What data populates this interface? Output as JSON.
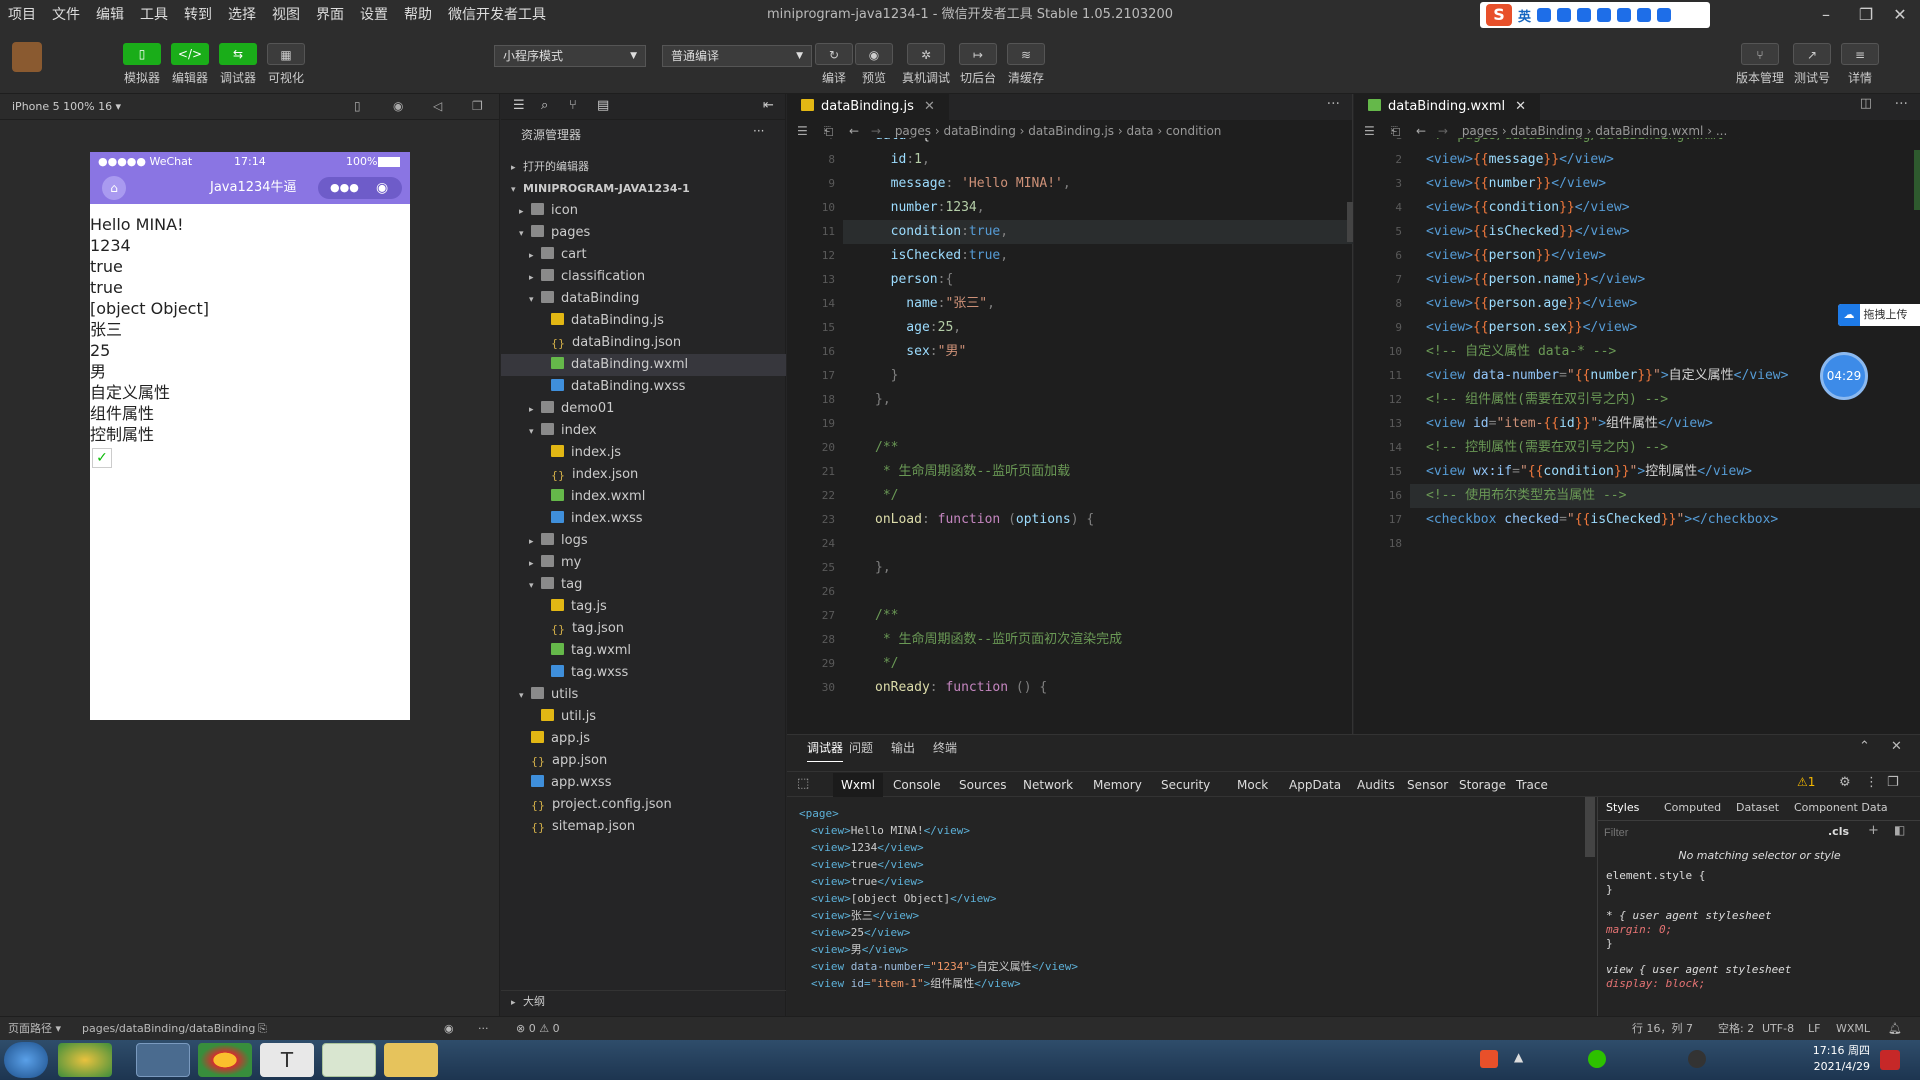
{
  "menu": [
    "项目",
    "文件",
    "编辑",
    "工具",
    "转到",
    "选择",
    "视图",
    "界面",
    "设置",
    "帮助",
    "微信开发者工具"
  ],
  "window_title": "miniprogram-java1234-1 - 微信开发者工具 Stable 1.05.2103200",
  "ime": {
    "mode": "英"
  },
  "toolbar": {
    "simulator": "模拟器",
    "editor": "编辑器",
    "debugger": "调试器",
    "visualize": "可视化",
    "mode_select": "小程序模式",
    "compile_select": "普通编译",
    "compile": "编译",
    "preview": "预览",
    "remote_debug": "真机调试",
    "backend": "切后台",
    "clear_cache": "清缓存",
    "version": "版本管理",
    "test": "测试号",
    "details": "详情"
  },
  "simulator": {
    "device": "iPhone 5 100% 16 ▾",
    "status_left": "●●●●● WeChat",
    "time": "17:14",
    "battery": "100%",
    "nav_title": "Java1234牛逼",
    "lines": [
      "Hello MINA!",
      "1234",
      "true",
      "true",
      "[object Object]",
      "张三",
      "25",
      "男",
      "自定义属性",
      "组件属性",
      "控制属性"
    ]
  },
  "explorer": {
    "title": "资源管理器",
    "open_editors": "打开的编辑器",
    "project": "MINIPROGRAM-JAVA1234-1",
    "outline": "大纲",
    "tree": [
      {
        "label": "icon",
        "depth": 1,
        "type": "folder",
        "twisty": "▸"
      },
      {
        "label": "pages",
        "depth": 1,
        "type": "folder",
        "twisty": "▾"
      },
      {
        "label": "cart",
        "depth": 2,
        "type": "folder",
        "twisty": "▸"
      },
      {
        "label": "classification",
        "depth": 2,
        "type": "folder",
        "twisty": "▸"
      },
      {
        "label": "dataBinding",
        "depth": 2,
        "type": "folder",
        "twisty": "▾"
      },
      {
        "label": "dataBinding.js",
        "depth": 3,
        "type": "js"
      },
      {
        "label": "dataBinding.json",
        "depth": 3,
        "type": "json"
      },
      {
        "label": "dataBinding.wxml",
        "depth": 3,
        "type": "wxml",
        "selected": true
      },
      {
        "label": "dataBinding.wxss",
        "depth": 3,
        "type": "wxss"
      },
      {
        "label": "demo01",
        "depth": 2,
        "type": "folder",
        "twisty": "▸"
      },
      {
        "label": "index",
        "depth": 2,
        "type": "folder",
        "twisty": "▾"
      },
      {
        "label": "index.js",
        "depth": 3,
        "type": "js"
      },
      {
        "label": "index.json",
        "depth": 3,
        "type": "json"
      },
      {
        "label": "index.wxml",
        "depth": 3,
        "type": "wxml"
      },
      {
        "label": "index.wxss",
        "depth": 3,
        "type": "wxss"
      },
      {
        "label": "logs",
        "depth": 2,
        "type": "folder",
        "twisty": "▸"
      },
      {
        "label": "my",
        "depth": 2,
        "type": "folder",
        "twisty": "▸"
      },
      {
        "label": "tag",
        "depth": 2,
        "type": "folder",
        "twisty": "▾"
      },
      {
        "label": "tag.js",
        "depth": 3,
        "type": "js"
      },
      {
        "label": "tag.json",
        "depth": 3,
        "type": "json"
      },
      {
        "label": "tag.wxml",
        "depth": 3,
        "type": "wxml"
      },
      {
        "label": "tag.wxss",
        "depth": 3,
        "type": "wxss"
      },
      {
        "label": "utils",
        "depth": 1,
        "type": "folder",
        "twisty": "▾"
      },
      {
        "label": "util.js",
        "depth": 2,
        "type": "js"
      },
      {
        "label": "app.js",
        "depth": 1,
        "type": "js"
      },
      {
        "label": "app.json",
        "depth": 1,
        "type": "json"
      },
      {
        "label": "app.wxss",
        "depth": 1,
        "type": "wxss"
      },
      {
        "label": "project.config.json",
        "depth": 1,
        "type": "json"
      },
      {
        "label": "sitemap.json",
        "depth": 1,
        "type": "json"
      }
    ]
  },
  "editor_js": {
    "tab": "dataBinding.js",
    "breadcrumb": "pages › dataBinding › dataBinding.js › data › condition",
    "lines": [
      {
        "n": "7",
        "tokens": [
          [
            "p",
            "data"
          ],
          [
            "x",
            ": "
          ],
          [
            "",
            "{"
          ]
        ]
      },
      {
        "n": "8",
        "tokens": [
          [
            "p",
            "  id"
          ],
          [
            "x",
            ":"
          ],
          [
            "n",
            "1"
          ],
          [
            "x",
            ","
          ]
        ]
      },
      {
        "n": "9",
        "tokens": [
          [
            "p",
            "  message"
          ],
          [
            "x",
            ": "
          ],
          [
            "s",
            "'Hello MINA!'"
          ],
          [
            "x",
            ","
          ]
        ]
      },
      {
        "n": "10",
        "tokens": [
          [
            "p",
            "  number"
          ],
          [
            "x",
            ":"
          ],
          [
            "n",
            "1234"
          ],
          [
            "x",
            ","
          ]
        ]
      },
      {
        "n": "11",
        "tokens": [
          [
            "p",
            "  condition"
          ],
          [
            "x",
            ":"
          ],
          [
            "t",
            "true"
          ],
          [
            "x",
            ","
          ]
        ]
      },
      {
        "n": "12",
        "tokens": [
          [
            "p",
            "  isChecked"
          ],
          [
            "x",
            ":"
          ],
          [
            "t",
            "true"
          ],
          [
            "x",
            ","
          ]
        ]
      },
      {
        "n": "13",
        "tokens": [
          [
            "p",
            "  person"
          ],
          [
            "x",
            ":{"
          ]
        ]
      },
      {
        "n": "14",
        "tokens": [
          [
            "p",
            "    name"
          ],
          [
            "x",
            ":"
          ],
          [
            "s",
            "\"张三\""
          ],
          [
            "x",
            ","
          ]
        ]
      },
      {
        "n": "15",
        "tokens": [
          [
            "p",
            "    age"
          ],
          [
            "x",
            ":"
          ],
          [
            "n",
            "25"
          ],
          [
            "x",
            ","
          ]
        ]
      },
      {
        "n": "16",
        "tokens": [
          [
            "p",
            "    sex"
          ],
          [
            "x",
            ":"
          ],
          [
            "s",
            "\"男\""
          ]
        ]
      },
      {
        "n": "17",
        "tokens": [
          [
            "x",
            "  }"
          ]
        ]
      },
      {
        "n": "18",
        "tokens": [
          [
            "x",
            "},"
          ]
        ]
      },
      {
        "n": "19",
        "tokens": []
      },
      {
        "n": "20",
        "tokens": [
          [
            "c",
            "/**"
          ]
        ]
      },
      {
        "n": "21",
        "tokens": [
          [
            "c",
            " * 生命周期函数--监听页面加载"
          ]
        ]
      },
      {
        "n": "22",
        "tokens": [
          [
            "c",
            " */"
          ]
        ]
      },
      {
        "n": "23",
        "tokens": [
          [
            "f",
            "onLoad"
          ],
          [
            "x",
            ": "
          ],
          [
            "k",
            "function"
          ],
          [
            "x",
            " ("
          ],
          [
            "p",
            "options"
          ],
          [
            "x",
            ") {"
          ]
        ]
      },
      {
        "n": "24",
        "tokens": []
      },
      {
        "n": "25",
        "tokens": [
          [
            "x",
            "},"
          ]
        ]
      },
      {
        "n": "26",
        "tokens": []
      },
      {
        "n": "27",
        "tokens": [
          [
            "c",
            "/**"
          ]
        ]
      },
      {
        "n": "28",
        "tokens": [
          [
            "c",
            " * 生命周期函数--监听页面初次渲染完成"
          ]
        ]
      },
      {
        "n": "29",
        "tokens": [
          [
            "c",
            " */"
          ]
        ]
      },
      {
        "n": "30",
        "tokens": [
          [
            "f",
            "onReady"
          ],
          [
            "x",
            ": "
          ],
          [
            "k",
            "function"
          ],
          [
            "x",
            " () {"
          ]
        ]
      }
    ]
  },
  "editor_wxml": {
    "tab": "dataBinding.wxml",
    "breadcrumb": "pages › dataBinding › dataBinding.wxml › ...",
    "upload_label": "拖拽上传",
    "timer": "04:29",
    "lines": [
      {
        "n": "1",
        "tokens": [
          [
            "c",
            "<!--pages/dataBinding/dataBinding.wxml-->"
          ]
        ]
      },
      {
        "n": "2",
        "tokens": [
          [
            "t",
            "<view>"
          ],
          [
            "tr",
            "{{"
          ],
          [
            "p",
            "message"
          ],
          [
            "tr",
            "}}"
          ],
          [
            "t",
            "</view>"
          ]
        ]
      },
      {
        "n": "3",
        "tokens": [
          [
            "t",
            "<view>"
          ],
          [
            "tr",
            "{{"
          ],
          [
            "p",
            "number"
          ],
          [
            "tr",
            "}}"
          ],
          [
            "t",
            "</view>"
          ]
        ]
      },
      {
        "n": "4",
        "tokens": [
          [
            "t",
            "<view>"
          ],
          [
            "tr",
            "{{"
          ],
          [
            "p",
            "condition"
          ],
          [
            "tr",
            "}}"
          ],
          [
            "t",
            "</view>"
          ]
        ]
      },
      {
        "n": "5",
        "tokens": [
          [
            "t",
            "<view>"
          ],
          [
            "tr",
            "{{"
          ],
          [
            "p",
            "isChecked"
          ],
          [
            "tr",
            "}}"
          ],
          [
            "t",
            "</view>"
          ]
        ]
      },
      {
        "n": "6",
        "tokens": [
          [
            "t",
            "<view>"
          ],
          [
            "tr",
            "{{"
          ],
          [
            "p",
            "person"
          ],
          [
            "tr",
            "}}"
          ],
          [
            "t",
            "</view>"
          ]
        ]
      },
      {
        "n": "7",
        "tokens": [
          [
            "t",
            "<view>"
          ],
          [
            "tr",
            "{{"
          ],
          [
            "p",
            "person.name"
          ],
          [
            "tr",
            "}}"
          ],
          [
            "t",
            "</view>"
          ]
        ]
      },
      {
        "n": "8",
        "tokens": [
          [
            "t",
            "<view>"
          ],
          [
            "tr",
            "{{"
          ],
          [
            "p",
            "person.age"
          ],
          [
            "tr",
            "}}"
          ],
          [
            "t",
            "</view>"
          ]
        ]
      },
      {
        "n": "9",
        "tokens": [
          [
            "t",
            "<view>"
          ],
          [
            "tr",
            "{{"
          ],
          [
            "p",
            "person.sex"
          ],
          [
            "tr",
            "}}"
          ],
          [
            "t",
            "</view>"
          ]
        ]
      },
      {
        "n": "10",
        "tokens": [
          [
            "c",
            "<!-- 自定义属性 data-* -->"
          ]
        ]
      },
      {
        "n": "11",
        "tokens": [
          [
            "t",
            "<view "
          ],
          [
            "a",
            "data-number"
          ],
          [
            "x",
            "="
          ],
          [
            "s",
            "\""
          ],
          [
            "tr",
            "{{"
          ],
          [
            "p",
            "number"
          ],
          [
            "tr",
            "}}"
          ],
          [
            "s",
            "\""
          ],
          [
            "t",
            ">"
          ],
          [
            "",
            "自定义属性"
          ],
          [
            "t",
            "</view>"
          ]
        ]
      },
      {
        "n": "12",
        "tokens": [
          [
            "c",
            "<!-- 组件属性(需要在双引号之内) -->"
          ]
        ]
      },
      {
        "n": "13",
        "tokens": [
          [
            "t",
            "<view "
          ],
          [
            "a",
            "id"
          ],
          [
            "x",
            "="
          ],
          [
            "s",
            "\"item-"
          ],
          [
            "tr",
            "{{"
          ],
          [
            "p",
            "id"
          ],
          [
            "tr",
            "}}"
          ],
          [
            "s",
            "\""
          ],
          [
            "t",
            ">"
          ],
          [
            "",
            "组件属性"
          ],
          [
            "t",
            "</view>"
          ]
        ]
      },
      {
        "n": "14",
        "tokens": [
          [
            "c",
            "<!-- 控制属性(需要在双引号之内) -->"
          ]
        ]
      },
      {
        "n": "15",
        "tokens": [
          [
            "t",
            "<view "
          ],
          [
            "a",
            "wx:if"
          ],
          [
            "x",
            "="
          ],
          [
            "s",
            "\""
          ],
          [
            "tr",
            "{{"
          ],
          [
            "p",
            "condition"
          ],
          [
            "tr",
            "}}"
          ],
          [
            "s",
            "\""
          ],
          [
            "t",
            ">"
          ],
          [
            "",
            "控制属性"
          ],
          [
            "t",
            "</view>"
          ]
        ]
      },
      {
        "n": "16",
        "tokens": [
          [
            "c",
            "<!-- 使用布尔类型充当属性 -->"
          ]
        ]
      },
      {
        "n": "17",
        "tokens": [
          [
            "t",
            "<checkbox "
          ],
          [
            "a",
            "checked"
          ],
          [
            "x",
            "="
          ],
          [
            "s",
            "\""
          ],
          [
            "tr",
            "{{"
          ],
          [
            "p",
            "isChecked"
          ],
          [
            "tr",
            "}}"
          ],
          [
            "s",
            "\""
          ],
          [
            "t",
            "></checkbox>"
          ]
        ]
      },
      {
        "n": "18",
        "tokens": []
      }
    ]
  },
  "devtools": {
    "top_tabs": [
      "调试器",
      "问题",
      "输出",
      "终端"
    ],
    "panel_tabs": [
      "Wxml",
      "Console",
      "Sources",
      "Network",
      "Memory",
      "Security",
      "Mock",
      "AppData",
      "Audits",
      "Sensor",
      "Storage",
      "Trace"
    ],
    "warning_count": "⚠1",
    "wxml_lines": [
      {
        "tag": "<page>",
        "text": "",
        "close": ""
      },
      {
        "tag": "<view>",
        "text": "Hello MINA!",
        "close": "</view>"
      },
      {
        "tag": "<view>",
        "text": "1234",
        "close": "</view>"
      },
      {
        "tag": "<view>",
        "text": "true",
        "close": "</view>"
      },
      {
        "tag": "<view>",
        "text": "true",
        "close": "</view>"
      },
      {
        "tag": "<view>",
        "text": "[object Object]",
        "close": "</view>"
      },
      {
        "tag": "<view>",
        "text": "张三",
        "close": "</view>"
      },
      {
        "tag": "<view>",
        "text": "25",
        "close": "</view>"
      },
      {
        "tag": "<view>",
        "text": "男",
        "close": "</view>"
      },
      {
        "tag": "<view data-number=\"1234\">",
        "text": "自定义属性",
        "close": "</view>"
      },
      {
        "tag": "<view id=\"item-1\">",
        "text": "组件属性",
        "close": "</view>"
      }
    ],
    "style_tabs": [
      "Styles",
      "Computed",
      "Dataset",
      "Component Data"
    ],
    "filter_placeholder": "Filter",
    "cls": ".cls",
    "no_match": "No matching selector or style",
    "rules": [
      "element.style {",
      "}",
      "* {                    user agent stylesheet",
      "    margin: 0;",
      "}",
      "view {                 user agent stylesheet",
      "    display: block;"
    ]
  },
  "statusbar": {
    "page_path_label": "页面路径 ▾",
    "page_path": "pages/dataBinding/dataBinding",
    "errors": "⊗ 0 ⚠ 0",
    "cursor": "行 16，列 7",
    "spaces": "空格: 2",
    "encoding": "UTF-8",
    "eol": "LF",
    "language": "WXML"
  },
  "taskbar": {
    "time": "17:16 周四",
    "date": "2021/4/29"
  }
}
